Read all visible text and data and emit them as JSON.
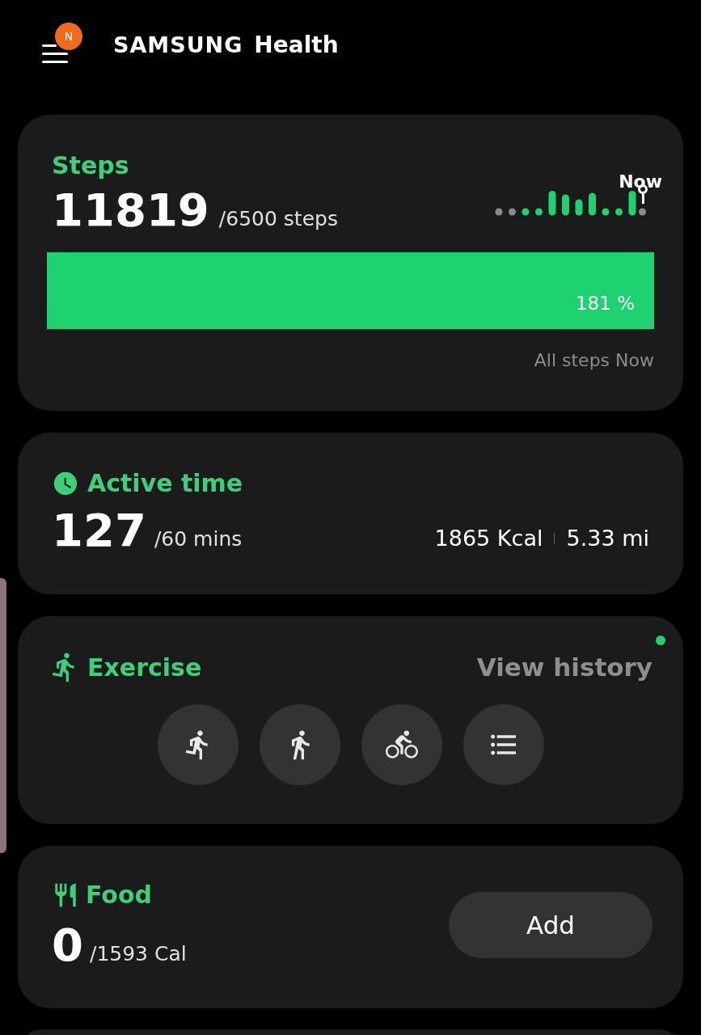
{
  "header": {
    "badge": "N",
    "brand": "SAMSUNG",
    "title": "Health"
  },
  "steps": {
    "title": "Steps",
    "value": "11819",
    "goal": "/6500 steps",
    "now_label": "Now",
    "level": 1,
    "percent": "181 %",
    "footer": "All steps Now"
  },
  "active_time": {
    "title": "Active time",
    "value": "127",
    "goal": "/60 mins",
    "calories": "1865 Kcal",
    "distance": "5.33 mi"
  },
  "exercise": {
    "title": "Exercise",
    "link": "View history",
    "new_indicator": true,
    "shortcuts": [
      {
        "kind": "run"
      },
      {
        "kind": "walk"
      },
      {
        "kind": "bike"
      },
      {
        "kind": "list"
      }
    ]
  },
  "food": {
    "title": "Food",
    "value": "0",
    "goal": "/1593 Cal",
    "button": "Add"
  }
}
